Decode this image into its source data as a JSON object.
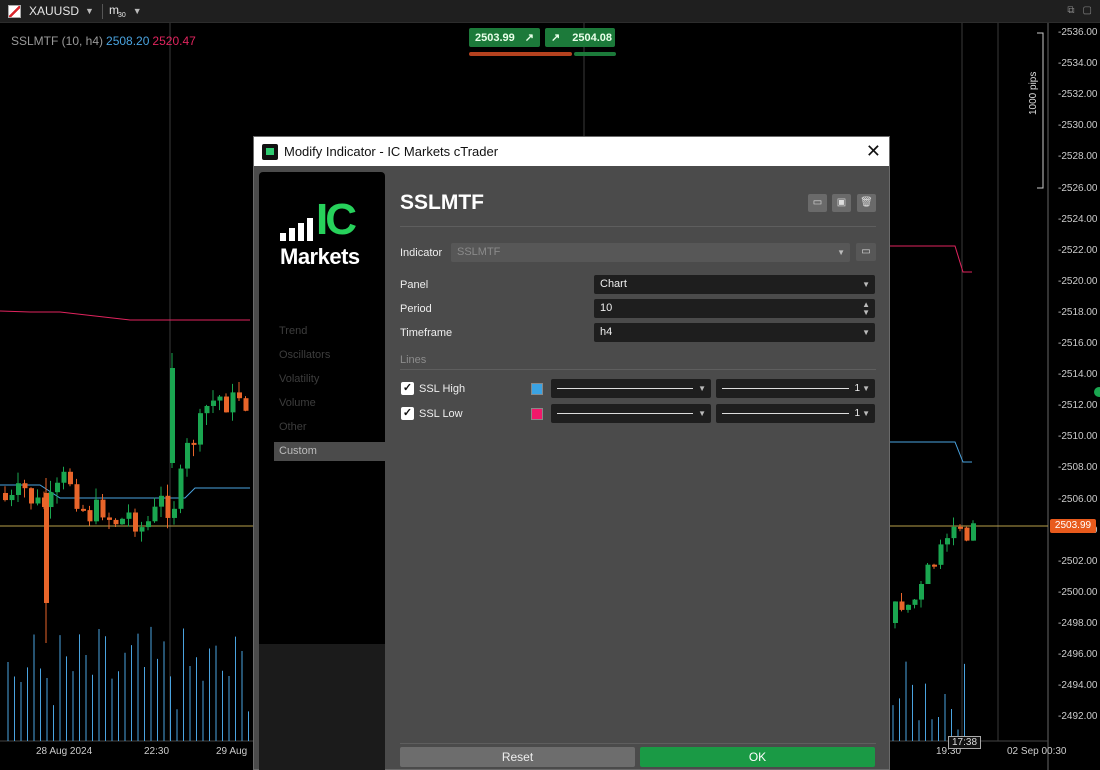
{
  "toolbar": {
    "symbol": "XAUUSD",
    "timeframe_main": "m",
    "timeframe_sub": "30"
  },
  "indicator_label": {
    "text": "SSLMTF (10, h4)",
    "high": "2508.20",
    "low": "2520.47"
  },
  "quotes": {
    "bid": "2503.99",
    "ask": "2504.08",
    "bid_color": "#1c7a3a",
    "bar_bid_color": "#b5421f",
    "bar_ask_color": "#1c7a3a"
  },
  "pips_label": "1000 pips",
  "price_axis": [
    "2536.00",
    "2534.00",
    "2532.00",
    "2530.00",
    "2528.00",
    "2526.00",
    "2524.00",
    "2522.00",
    "2520.00",
    "2518.00",
    "2516.00",
    "2514.00",
    "2512.00",
    "2510.00",
    "2508.00",
    "2506.00",
    "2504.00",
    "2502.00",
    "2500.00",
    "2498.00",
    "2496.00",
    "2494.00",
    "2492.00"
  ],
  "current_price_tag": "2503.99",
  "time_axis": [
    "28 Aug 2024",
    "22:30",
    "29 Aug",
    "19:30",
    "02 Sep 00:30"
  ],
  "time_tag": "17:38",
  "colors": {
    "ssl_high": "#4aa3df",
    "ssl_low": "#e0245e",
    "up_candle": "#1aa650",
    "down_candle": "#e8652a",
    "accent_green": "#1a9a45"
  },
  "dialog": {
    "title": "Modify Indicator - IC Markets cTrader",
    "logo": {
      "ic": "IC",
      "markets": "Markets"
    },
    "sidebar": [
      "Trend",
      "Oscillators",
      "Volatility",
      "Volume",
      "Other",
      "Custom"
    ],
    "indicator_name": "SSLMTF",
    "indicator_label": "Indicator",
    "indicator_value": "SSLMTF",
    "params": [
      {
        "label": "Panel",
        "value": "Chart"
      },
      {
        "label": "Period",
        "value": "10"
      },
      {
        "label": "Timeframe",
        "value": "h4"
      }
    ],
    "lines_section": "Lines",
    "lines": [
      {
        "name": "SSL High",
        "checked": true,
        "color": "#3ba3e3",
        "thickness": "1"
      },
      {
        "name": "SSL Low",
        "checked": true,
        "color": "#f0186a",
        "thickness": "1"
      }
    ],
    "reset_label": "Reset",
    "ok_label": "OK"
  }
}
